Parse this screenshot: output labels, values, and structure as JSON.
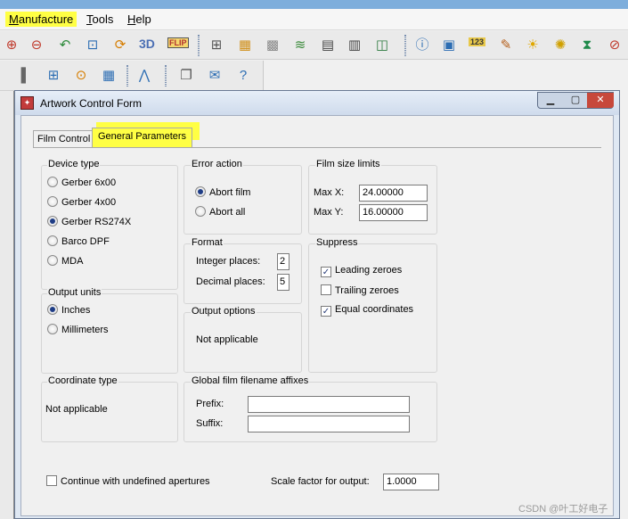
{
  "menu": {
    "manufacture": {
      "accel": "M",
      "rest": "anufacture"
    },
    "tools": {
      "accel": "T",
      "rest": "ools"
    },
    "help": {
      "accel": "H",
      "rest": "elp"
    }
  },
  "toolbar": {
    "text_3d": "3D",
    "text_flip": "FLIP",
    "text_123": "123"
  },
  "window": {
    "title": "Artwork Control Form",
    "min_glyph": "▁",
    "max_glyph": "▢",
    "close_glyph": "✕"
  },
  "tabs": [
    {
      "label": "Film Control",
      "active": false
    },
    {
      "label": "General Parameters",
      "active": true
    }
  ],
  "device_type": {
    "title": "Device type",
    "options": [
      {
        "label": "Gerber 6x00",
        "selected": false
      },
      {
        "label": "Gerber 4x00",
        "selected": false
      },
      {
        "label": "Gerber RS274X",
        "selected": true
      },
      {
        "label": "Barco DPF",
        "selected": false
      },
      {
        "label": "MDA",
        "selected": false
      }
    ]
  },
  "output_units": {
    "title": "Output units",
    "options": [
      {
        "label": "Inches",
        "selected": true
      },
      {
        "label": "Millimeters",
        "selected": false
      }
    ]
  },
  "coordinate_type": {
    "title": "Coordinate type",
    "value": "Not applicable"
  },
  "error_action": {
    "title": "Error action",
    "options": [
      {
        "label": "Abort film",
        "selected": true
      },
      {
        "label": "Abort all",
        "selected": false
      }
    ]
  },
  "format": {
    "title": "Format",
    "integer_label": "Integer places:",
    "integer_value": "2",
    "decimal_label": "Decimal places:",
    "decimal_value": "5"
  },
  "output_options": {
    "title": "Output options",
    "value": "Not applicable"
  },
  "film_size": {
    "title": "Film size limits",
    "max_x_label": "Max X:",
    "max_x_value": "24.00000",
    "max_y_label": "Max Y:",
    "max_y_value": "16.00000"
  },
  "suppress": {
    "title": "Suppress",
    "options": [
      {
        "label": "Leading zeroes",
        "checked": true
      },
      {
        "label": "Trailing zeroes",
        "checked": false
      },
      {
        "label": "Equal coordinates",
        "checked": true
      }
    ]
  },
  "affixes": {
    "title": "Global film filename affixes",
    "prefix_label": "Prefix:",
    "prefix_value": "",
    "suffix_label": "Suffix:",
    "suffix_value": ""
  },
  "bottom": {
    "continue_label": "Continue with undefined apertures",
    "continue_checked": false,
    "scale_label": "Scale factor for output:",
    "scale_value": "1.0000"
  },
  "watermark": "CSDN @叶工好电子",
  "check_glyph": "✓",
  "colors": {
    "highlight": "#ffff44",
    "title_blue": "#1f3d86"
  }
}
